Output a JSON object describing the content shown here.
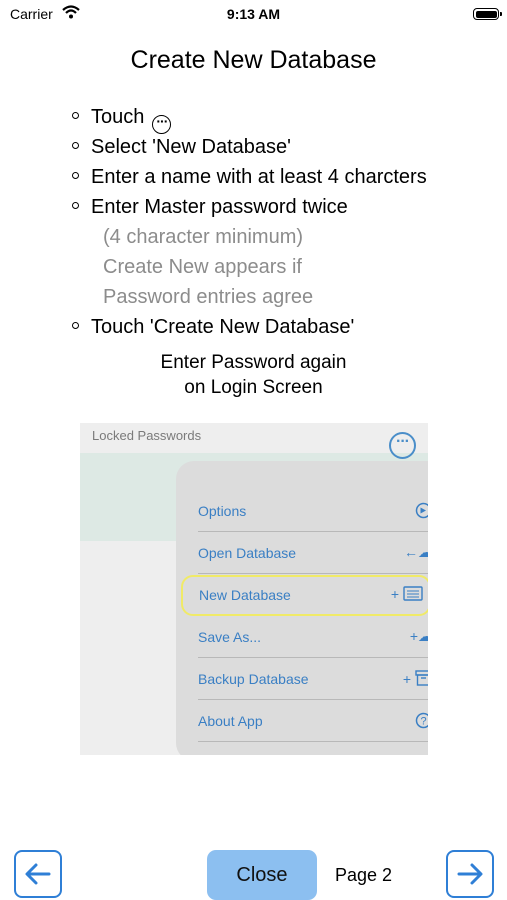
{
  "status_bar": {
    "carrier": "Carrier",
    "time": "9:13 AM"
  },
  "title": "Create New Database",
  "steps": [
    {
      "text": "Touch",
      "icon": "more-circle-icon"
    },
    {
      "text": "Select 'New Database'"
    },
    {
      "text": "Enter a name with at least 4 charcters"
    },
    {
      "text": "Enter Master password twice"
    },
    {
      "text": "(4 character minimum)",
      "sub": true
    },
    {
      "text": "Create New appears if",
      "sub": true
    },
    {
      "text": "Password entries agree",
      "sub": true
    },
    {
      "text": "Touch 'Create New Database'"
    }
  ],
  "note": {
    "line1": "Enter Password again",
    "line2": "on Login Screen"
  },
  "screenshot": {
    "header": "Locked Passwords",
    "menu_items": [
      {
        "label": "Options",
        "icon": "gear-icon"
      },
      {
        "label": "Open Database",
        "icon": "cloud-download-icon"
      },
      {
        "label": "New Database",
        "icon": "new-document-icon",
        "highlighted": true
      },
      {
        "label": "Save As...",
        "icon": "cloud-upload-icon"
      },
      {
        "label": "Backup Database",
        "icon": "archive-icon"
      },
      {
        "label": "About App",
        "icon": "help-icon"
      }
    ]
  },
  "footer": {
    "close_label": "Close",
    "page_label": "Page 2"
  },
  "colors": {
    "accent": "#2f7fd6",
    "close_bg": "#8cbff0",
    "menu_text": "#3a7fc4",
    "highlight": "#f0ea67"
  }
}
